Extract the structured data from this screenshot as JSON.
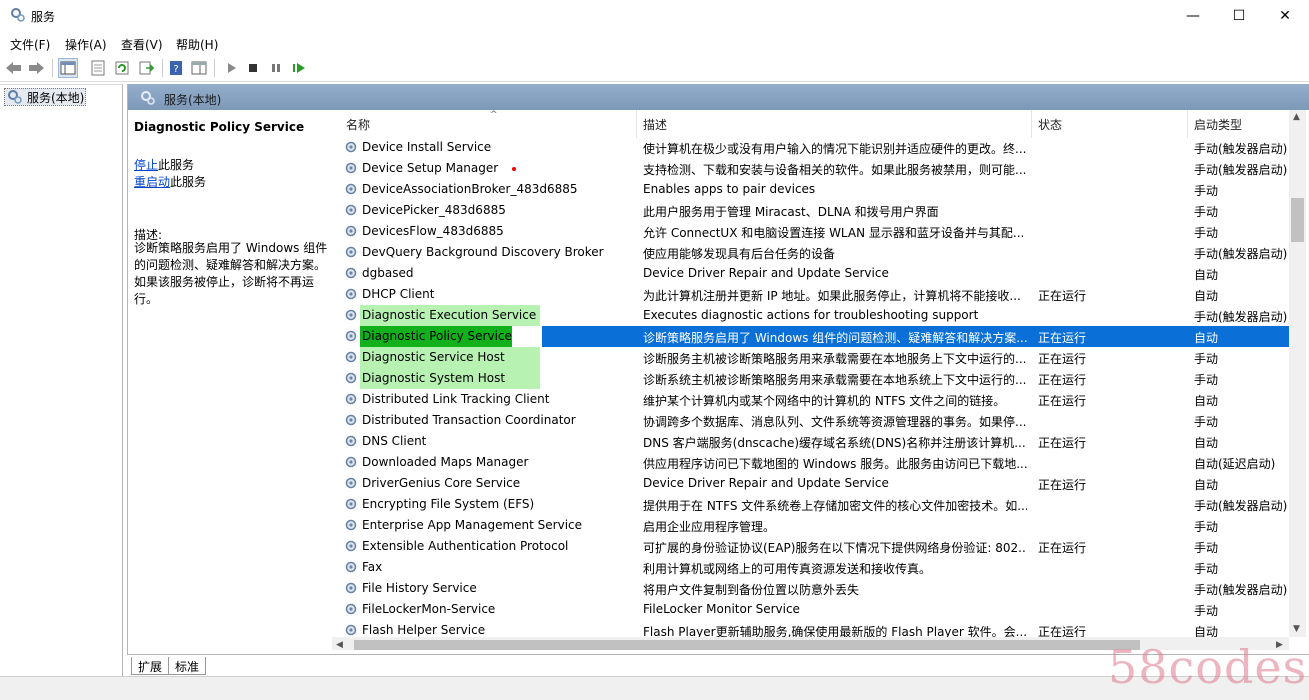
{
  "window": {
    "title": "服务",
    "minimize": "—",
    "maximize": "☐",
    "close": "✕"
  },
  "menu": [
    "文件(F)",
    "操作(A)",
    "查看(V)",
    "帮助(H)"
  ],
  "tree": {
    "item": "服务(本地)"
  },
  "panel": {
    "header": "服务(本地)"
  },
  "details": {
    "service_title": "Diagnostic Policy Service",
    "stop_link": "停止",
    "stop_suffix": "此服务",
    "restart_link": "重启动",
    "restart_suffix": "此服务",
    "desc_label": "描述:",
    "desc_text": "诊断策略服务启用了 Windows 组件的问题检测、疑难解答和解决方案。如果该服务被停止，诊断将不再运行。"
  },
  "columns": {
    "name": "名称",
    "desc": "描述",
    "status": "状态",
    "start": "启动类型"
  },
  "rows": [
    {
      "name": "Device Install Service",
      "desc": "使计算机在极少或没有用户输入的情况下能识别并适应硬件的更改。终...",
      "status": "",
      "start": "手动(触发器启动)"
    },
    {
      "name": "Device Setup Manager",
      "desc": "支持检测、下载和安装与设备相关的软件。如果此服务被禁用，则可能...",
      "status": "",
      "start": "手动(触发器启动)"
    },
    {
      "name": "DeviceAssociationBroker_483d6885",
      "desc": "Enables apps to pair devices",
      "status": "",
      "start": "手动"
    },
    {
      "name": "DevicePicker_483d6885",
      "desc": "此用户服务用于管理 Miracast、DLNA 和拨号用户界面",
      "status": "",
      "start": "手动"
    },
    {
      "name": "DevicesFlow_483d6885",
      "desc": "允许 ConnectUX 和电脑设置连接 WLAN 显示器和蓝牙设备并与其配...",
      "status": "",
      "start": "手动"
    },
    {
      "name": "DevQuery Background Discovery Broker",
      "desc": "使应用能够发现具有后台任务的设备",
      "status": "",
      "start": "手动(触发器启动)"
    },
    {
      "name": "dgbased",
      "desc": "Device Driver Repair and Update Service",
      "status": "",
      "start": "自动"
    },
    {
      "name": "DHCP Client",
      "desc": "为此计算机注册并更新 IP 地址。如果此服务停止，计算机将不能接收...",
      "status": "正在运行",
      "start": "自动"
    },
    {
      "name": "Diagnostic Execution Service",
      "desc": "Executes diagnostic actions for troubleshooting support",
      "status": "",
      "start": "手动(触发器启动)"
    },
    {
      "name": "Diagnostic Policy Service",
      "desc": "诊断策略服务启用了 Windows 组件的问题检测、疑难解答和解决方案...",
      "status": "正在运行",
      "start": "自动"
    },
    {
      "name": "Diagnostic Service Host",
      "desc": "诊断服务主机被诊断策略服务用来承载需要在本地服务上下文中运行的...",
      "status": "正在运行",
      "start": "手动"
    },
    {
      "name": "Diagnostic System Host",
      "desc": "诊断系统主机被诊断策略服务用来承载需要在本地系统上下文中运行的...",
      "status": "正在运行",
      "start": "手动"
    },
    {
      "name": "Distributed Link Tracking Client",
      "desc": "维护某个计算机内或某个网络中的计算机的 NTFS 文件之间的链接。",
      "status": "正在运行",
      "start": "自动"
    },
    {
      "name": "Distributed Transaction Coordinator",
      "desc": "协调跨多个数据库、消息队列、文件系统等资源管理器的事务。如果停...",
      "status": "",
      "start": "手动"
    },
    {
      "name": "DNS Client",
      "desc": "DNS 客户端服务(dnscache)缓存域名系统(DNS)名称并注册该计算机...",
      "status": "正在运行",
      "start": "自动"
    },
    {
      "name": "Downloaded Maps Manager",
      "desc": "供应用程序访问已下载地图的 Windows 服务。此服务由访问已下载地...",
      "status": "",
      "start": "自动(延迟启动)"
    },
    {
      "name": "DriverGenius Core Service",
      "desc": "Device Driver Repair and Update Service",
      "status": "正在运行",
      "start": "自动"
    },
    {
      "name": "Encrypting File System (EFS)",
      "desc": "提供用于在 NTFS 文件系统卷上存储加密文件的核心文件加密技术。如...",
      "status": "",
      "start": "手动(触发器启动)"
    },
    {
      "name": "Enterprise App Management Service",
      "desc": "启用企业应用程序管理。",
      "status": "",
      "start": "手动"
    },
    {
      "name": "Extensible Authentication Protocol",
      "desc": "可扩展的身份验证协议(EAP)服务在以下情况下提供网络身份验证: 802....",
      "status": "正在运行",
      "start": "手动"
    },
    {
      "name": "Fax",
      "desc": "利用计算机或网络上的可用传真资源发送和接收传真。",
      "status": "",
      "start": "手动"
    },
    {
      "name": "File History Service",
      "desc": "将用户文件复制到备份位置以防意外丢失",
      "status": "",
      "start": "手动(触发器启动)"
    },
    {
      "name": "FileLockerMon-Service",
      "desc": "FileLocker Monitor Service",
      "status": "",
      "start": "手动"
    },
    {
      "name": "Flash Helper Service",
      "desc": "Flash Player更新辅助服务,确保使用最新版的 Flash Player 软件。会...",
      "status": "正在运行",
      "start": "自动"
    }
  ],
  "tabs": [
    "扩展",
    "标准"
  ],
  "watermark": "58codes"
}
